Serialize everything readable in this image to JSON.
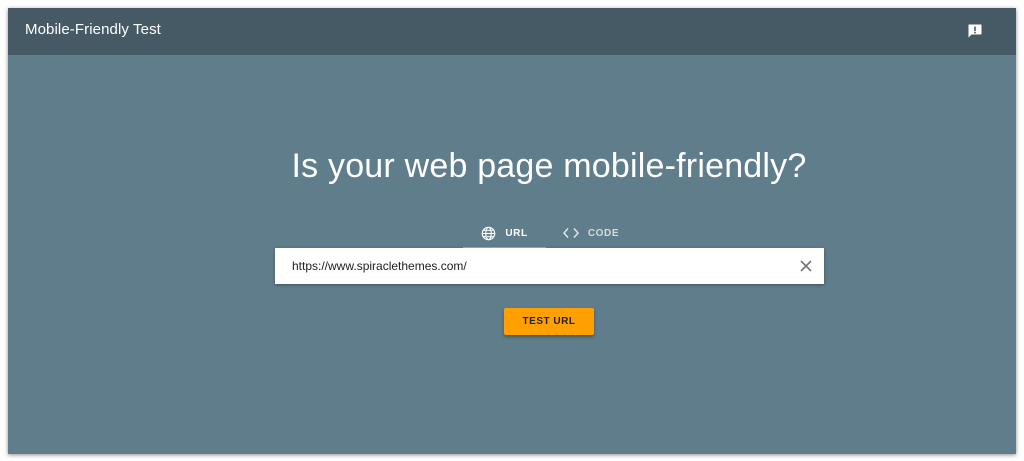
{
  "header": {
    "title": "Mobile-Friendly Test",
    "feedback_icon": "feedback-icon"
  },
  "main": {
    "headline": "Is your web page mobile-friendly?",
    "tabs": [
      {
        "label": "URL",
        "icon": "globe-icon",
        "active": true
      },
      {
        "label": "CODE",
        "icon": "code-icon",
        "active": false
      }
    ],
    "url_input": {
      "value": "https://www.spiraclethemes.com/",
      "clear_icon": "close-icon"
    },
    "test_button_label": "TEST URL"
  },
  "colors": {
    "appbar": "#455a64",
    "background": "#607d8b",
    "accent": "#ffa000"
  }
}
